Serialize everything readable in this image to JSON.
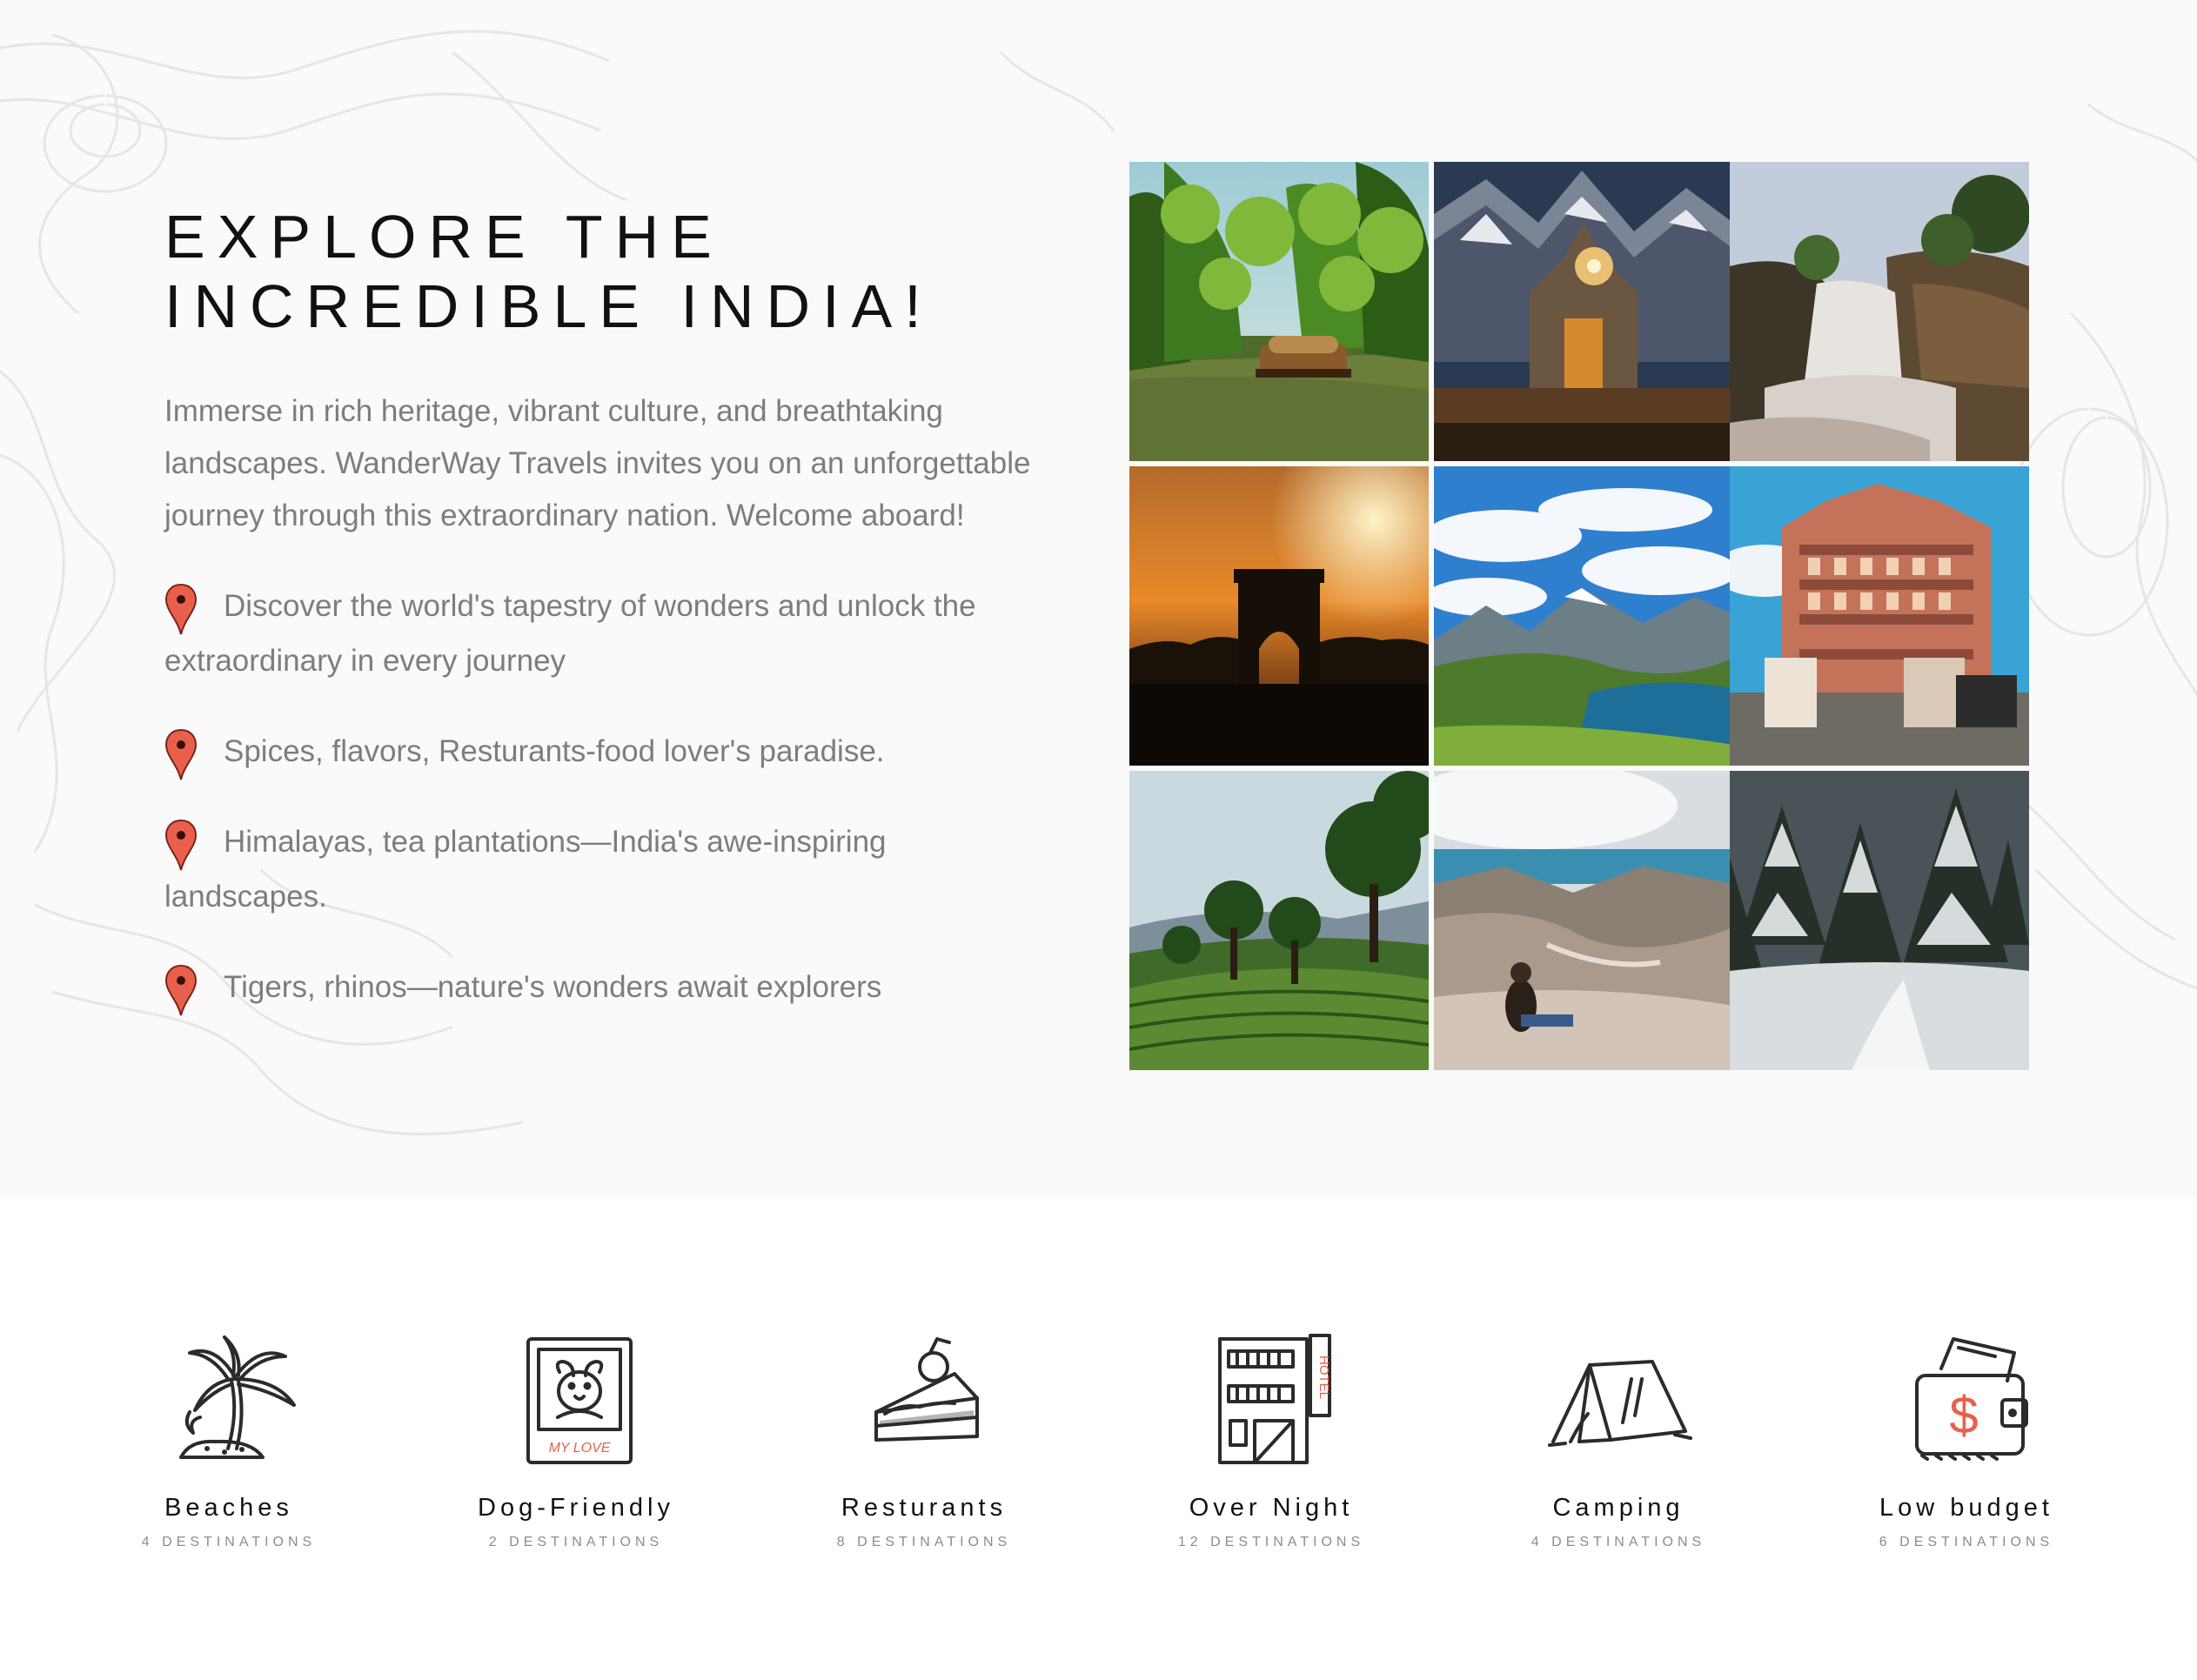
{
  "hero": {
    "title_line1": "EXPLORE THE",
    "title_line2": "INCREDIBLE INDIA!",
    "intro": "Immerse in rich heritage, vibrant culture, and breathtaking landscapes. WanderWay Travels invites you on an unforgettable journey through this extraordinary nation. Welcome aboard!",
    "features": [
      {
        "icon": "map-pin-icon",
        "text": "Discover the world's tapestry of wonders and unlock the extraordinary in every journey"
      },
      {
        "icon": "map-pin-icon",
        "text": "Spices, flavors, Resturants-food lover's paradise."
      },
      {
        "icon": "map-pin-icon",
        "text": "Himalayas, tea plantations—India's awe-inspiring landscapes."
      },
      {
        "icon": "map-pin-icon",
        "text": "Tigers, rhinos—nature's wonders await explorers"
      }
    ],
    "pin_color": "#e8604c"
  },
  "gallery": {
    "photos": [
      {
        "subject": "kerala-backwaters-houseboat"
      },
      {
        "subject": "kedarnath-temple-night"
      },
      {
        "subject": "waterfall-cliffs"
      },
      {
        "subject": "india-gate-sunset"
      },
      {
        "subject": "himalayan-lake-valley"
      },
      {
        "subject": "hawa-mahal-jaipur"
      },
      {
        "subject": "tea-plantation-hills"
      },
      {
        "subject": "mountain-valley-traveler"
      },
      {
        "subject": "snowy-pine-forest"
      }
    ]
  },
  "categories": {
    "items": [
      {
        "icon": "palm-tree-icon",
        "name": "Beaches",
        "count": "4 DESTINATIONS"
      },
      {
        "icon": "dog-photo-icon",
        "name": "Dog-Friendly",
        "count": "2 DESTINATIONS"
      },
      {
        "icon": "cake-slice-icon",
        "name": "Resturants",
        "count": "8 DESTINATIONS"
      },
      {
        "icon": "hotel-building-icon",
        "name": "Over Night",
        "count": "12 DESTINATIONS"
      },
      {
        "icon": "tent-icon",
        "name": "Camping",
        "count": "4 DESTINATIONS"
      },
      {
        "icon": "wallet-dollar-icon",
        "name": "Low budget",
        "count": "6 DESTINATIONS"
      }
    ]
  }
}
